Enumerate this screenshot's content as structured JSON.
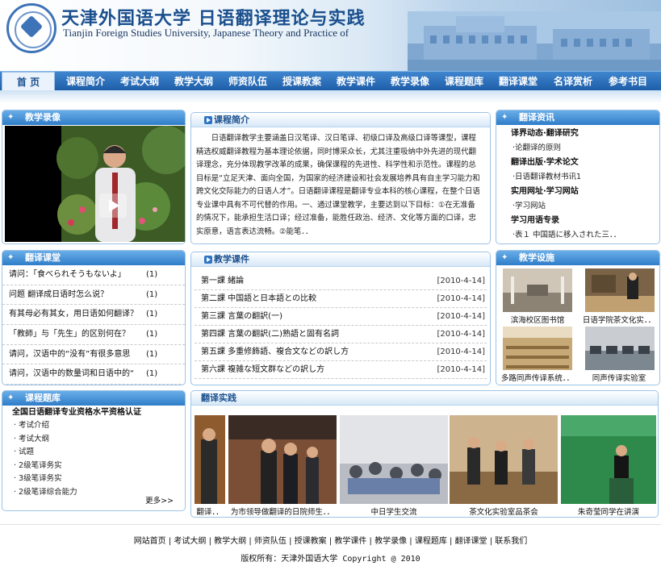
{
  "header": {
    "title_cn": "天津外国语大学 日语翻译理论与实践",
    "title_en": "Tianjin Foreign Studies University, Japanese Theory and Practice of"
  },
  "nav": {
    "items": [
      "首 页",
      "课程简介",
      "考试大纲",
      "教学大纲",
      "师资队伍",
      "授课教案",
      "教学课件",
      "教学录像",
      "课程题库",
      "翻译课堂",
      "名译赏析",
      "参考书目"
    ]
  },
  "video_panel": {
    "title": "教学录像"
  },
  "intro_panel": {
    "title": "课程简介",
    "text": "日语翻译教学主要涵盖日汉笔译、汉日笔译、初级口译及高级口译等课型，课程精选权威翻译教程为基本理论依据，同时博采众长，尤其注重吸纳中外先进的现代翻译理念，充分体现教学改革的成果，确保课程的先进性、科学性和示范性。课程的总目标是“立足天津、面向全国，为国家的经济建设和社会发展培养具有自主学习能力和跨文化交际能力的日语人才”。日语翻译课程是翻译专业本科的核心课程，在整个日语专业课中具有不可代替的作用。一、通过课堂教学，主要达到以下目标：①在无准备的情况下，能承担生活口译；经过准备，能胜任政治、经济、文化等方面的口译，忠实原意，语言表达流畅。②能笔．．"
  },
  "news_panel": {
    "title": "翻译资讯",
    "groups": [
      {
        "heading": "译界动态·翻译研究",
        "items": [
          "·论翻译的原则"
        ]
      },
      {
        "heading": "翻译出版·学术论文",
        "items": [
          "·日语翻译教材书讯1"
        ]
      },
      {
        "heading": "实用网址·学习网站",
        "items": [
          "·学习网站"
        ]
      },
      {
        "heading": "学习用语专录",
        "items": [
          "·表１ 中国語に移入された三．．"
        ]
      }
    ]
  },
  "classroom_panel": {
    "title": "翻译课堂",
    "rows": [
      {
        "text": "请问：「食べられそうもないよ」",
        "count": "(1)"
      },
      {
        "text": "问题 翻译成日语时怎么说？",
        "count": "(1)"
      },
      {
        "text": "有其母必有其女，用日语如何翻译？",
        "count": "(1)"
      },
      {
        "text": "「教師」与「先生」的区别何在？",
        "count": "(1)"
      },
      {
        "text": "请问，汉语中的“没有”有很多意思",
        "count": "(1)"
      },
      {
        "text": "请问，汉语中的数量词和日语中的“",
        "count": "(1)"
      }
    ]
  },
  "courseware_panel": {
    "title": "教学课件",
    "rows": [
      {
        "text": "第一課 緒論",
        "date": "[2010-4-14]"
      },
      {
        "text": "第二課 中国語と日本語との比較",
        "date": "[2010-4-14]"
      },
      {
        "text": "第三課 言葉の翻訳(一)",
        "date": "[2010-4-14]"
      },
      {
        "text": "第四課 言葉の翻訳(二)熟語と固有名詞",
        "date": "[2010-4-14]"
      },
      {
        "text": "第五課 多重修飾語、複合文などの訳し方",
        "date": "[2010-4-14]"
      },
      {
        "text": "第六課 複雑な短文群などの訳し方",
        "date": "[2010-4-14]"
      }
    ]
  },
  "facilities_panel": {
    "title": "教学设施",
    "captions": [
      "滨海校区图书馆",
      "日语学院茶文化实．．",
      "多路同声传译系统．．",
      "同声传译实验室"
    ]
  },
  "bank_panel": {
    "title": "课程题库",
    "heading": "全国日语翻译专业资格水平资格认证",
    "items": [
      "· 考试介绍",
      "· 考试大纲",
      "· 试题",
      "· 2级笔译务实",
      "· 3级笔译务实",
      "· 2级笔译综合能力"
    ],
    "more": "更多>>"
  },
  "practice_panel": {
    "title": "翻译实践",
    "captions": [
      "翻译．．",
      "为市领导做翻译的日院师生．．",
      "中日学生交流",
      "茶文化实验室品茶会",
      "朱奇莹同学在讲演"
    ]
  },
  "footer": {
    "links": [
      "网站首页",
      "考试大纲",
      "教学大纲",
      "师资队伍",
      "授课教案",
      "教学课件",
      "教学录像",
      "课程题库",
      "翻译课堂",
      "联系我们"
    ],
    "separator": " | ",
    "copyright": "版权所有：天津外国语大学 Copyright @ 2010"
  }
}
